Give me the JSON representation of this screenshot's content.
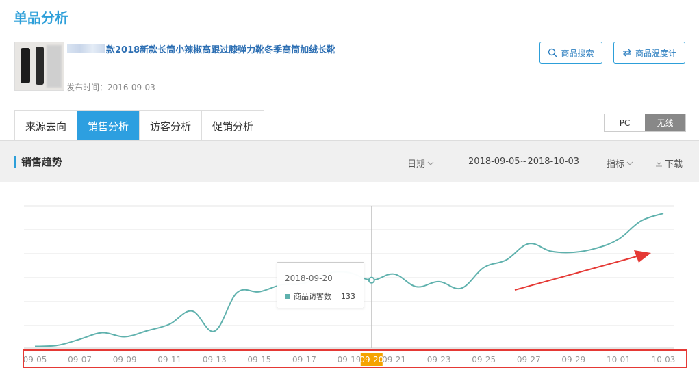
{
  "page": {
    "title": "单品分析"
  },
  "product": {
    "title": "款2018新款长筒小辣椒高跟过膝弹力靴冬季高筒加绒长靴",
    "publish_label": "发布时间：",
    "publish_date": "2016-09-03"
  },
  "actions": {
    "search_label": "商品搜索",
    "thermo_label": "商品温度计"
  },
  "tabs": [
    {
      "label": "来源去向",
      "active": false
    },
    {
      "label": "销售分析",
      "active": true
    },
    {
      "label": "访客分析",
      "active": false
    },
    {
      "label": "促销分析",
      "active": false
    }
  ],
  "device_toggle": [
    {
      "label": "PC",
      "active": false
    },
    {
      "label": "无线",
      "active": true
    }
  ],
  "section": {
    "title": "销售趋势",
    "date_label": "日期",
    "date_range": "2018-09-05~2018-10-03",
    "metric_label": "指标",
    "download_label": "下载"
  },
  "tooltip": {
    "date": "2018-09-20",
    "series": "商品访客数",
    "value": "133"
  },
  "colors": {
    "accent": "#2d9fd9",
    "line": "#5fb1ad",
    "highlight": "#e53935",
    "axis_highlight": "#f5a300"
  },
  "chart_data": {
    "type": "line",
    "series": [
      {
        "name": "商品访客数",
        "x": [
          "09-05",
          "09-06",
          "09-07",
          "09-08",
          "09-09",
          "09-10",
          "09-11",
          "09-12",
          "09-13",
          "09-14",
          "09-15",
          "09-16",
          "09-17",
          "09-18",
          "09-19",
          "09-20",
          "09-21",
          "09-22",
          "09-23",
          "09-24",
          "09-25",
          "09-26",
          "09-27",
          "09-28",
          "09-29",
          "09-30",
          "10-01",
          "10-02",
          "10-03"
        ],
        "values": [
          2,
          4,
          16,
          29,
          21,
          33,
          46,
          72,
          32,
          108,
          110,
          124,
          127,
          146,
          148,
          133,
          145,
          120,
          130,
          117,
          158,
          173,
          205,
          190,
          188,
          196,
          214,
          250,
          265
        ]
      }
    ],
    "x_tick_labels": [
      "09-05",
      "09-07",
      "09-09",
      "09-11",
      "09-13",
      "09-15",
      "09-17",
      "09-19",
      "09-20",
      "09-21",
      "09-23",
      "09-25",
      "09-27",
      "09-29",
      "10-01",
      "10-03"
    ],
    "highlighted_x": "09-20",
    "grid": true,
    "xlabel": "",
    "ylabel": ""
  }
}
